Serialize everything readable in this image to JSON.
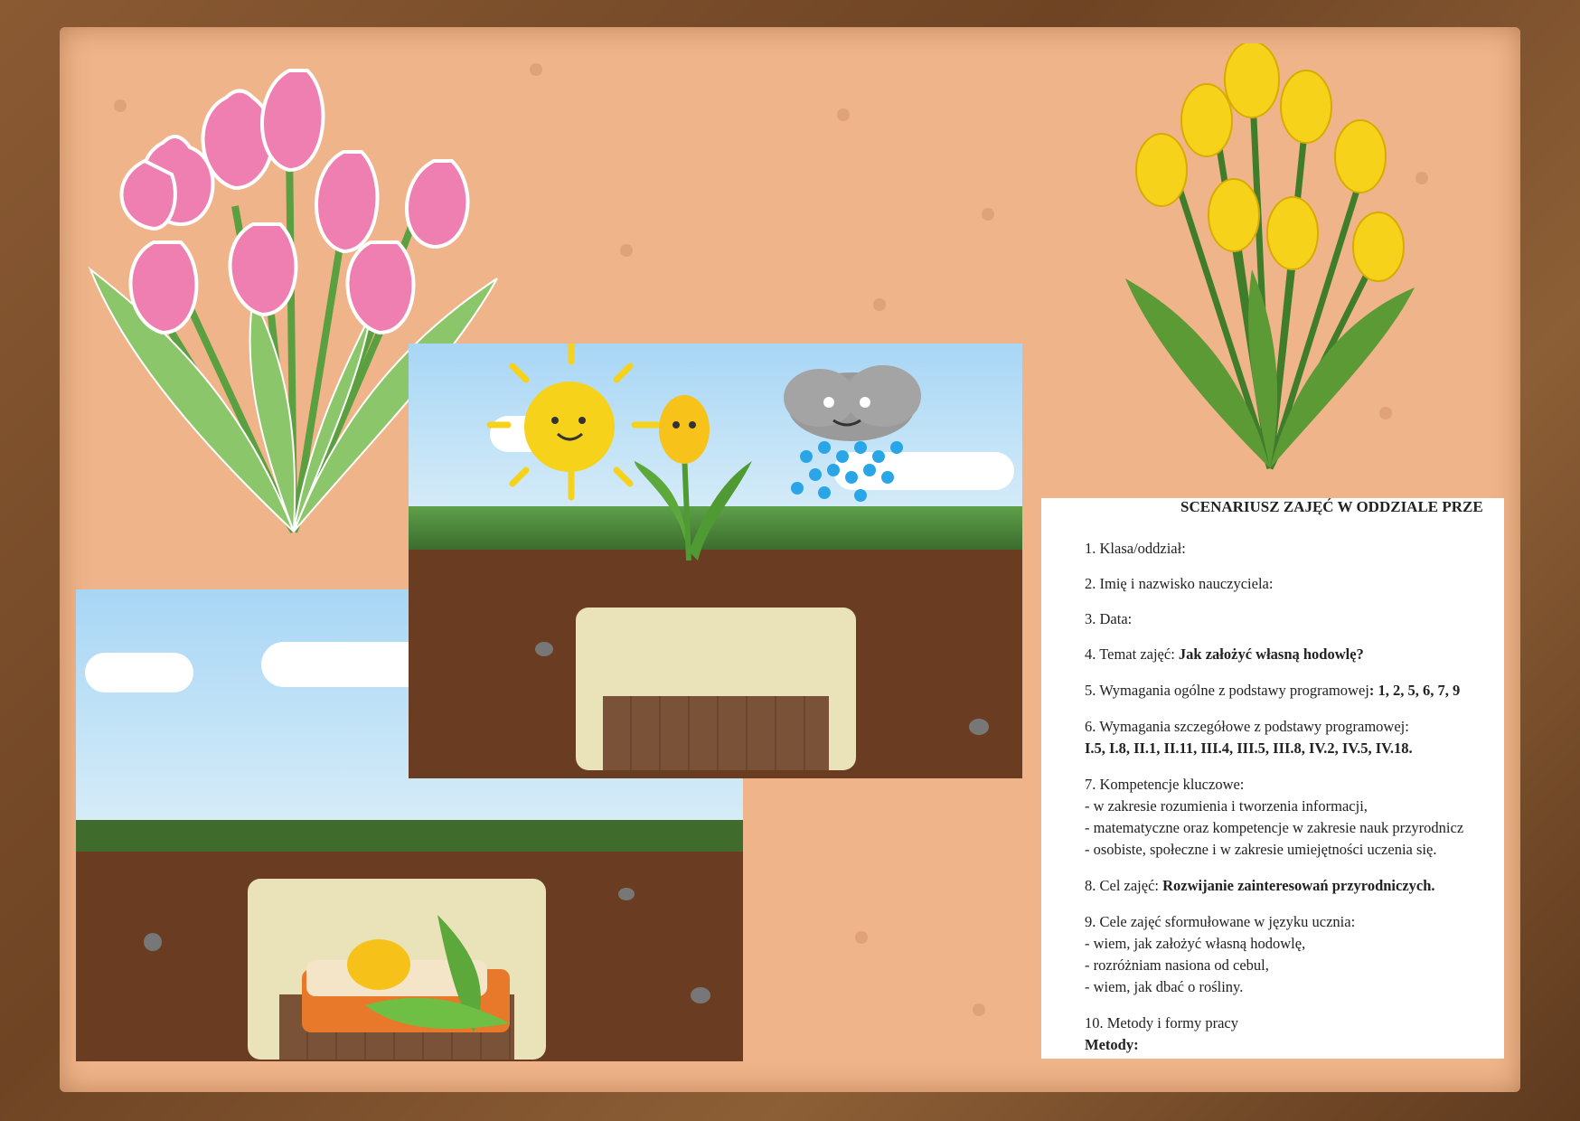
{
  "document": {
    "title": "SCENARIUSZ ZAJĘĆ W ODDZIALE PRZE",
    "items": [
      {
        "label": "1. Klasa/oddział:"
      },
      {
        "label": "2. Imię i nazwisko nauczyciela:"
      },
      {
        "label": "3. Data:"
      },
      {
        "label": "4. Temat zajęć:",
        "value": "Jak założyć własną hodowlę?"
      },
      {
        "label": "5. Wymagania ogólne z podstawy programowej",
        "value": ": 1, 2, 5, 6, 7, 9"
      },
      {
        "label": "6. Wymagania szczegółowe z podstawy programowej:",
        "value": "I.5, I.8, II.1, II.11, III.4, III.5, III.8, IV.2, IV.5, IV.18."
      },
      {
        "label": "7. Kompetencje kluczowe:",
        "lines": [
          "- w zakresie rozumienia i tworzenia informacji,",
          "- matematyczne oraz kompetencje w zakresie nauk przyrodnicz",
          "- osobiste, społeczne i w zakresie umiejętności uczenia się."
        ]
      },
      {
        "label": "8. Cel zajęć:",
        "value": "Rozwijanie zainteresowań przyrodniczych."
      },
      {
        "label": "9. Cele zajęć sformułowane w języku ucznia:",
        "lines": [
          "- wiem, jak założyć własną hodowlę,",
          "- rozróżniam nasiona od cebul,",
          "- wiem, jak dbać o rośliny."
        ]
      },
      {
        "label": "10. Metody i formy pracy",
        "value": "Metody:"
      }
    ]
  },
  "colors": {
    "frame": "#6e4424",
    "board": "#f0b48a",
    "pink_tulip": "#ef7fb0",
    "yellow_tulip": "#f6d21a"
  }
}
